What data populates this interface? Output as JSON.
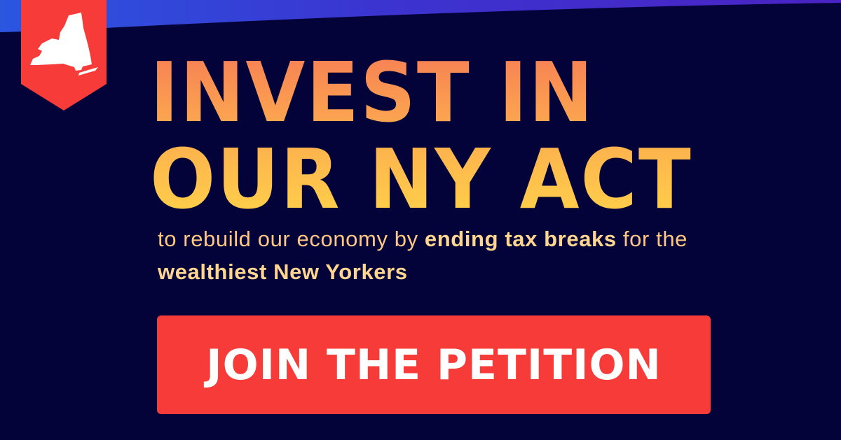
{
  "headline": {
    "line1": "INVEST IN",
    "line2": "OUR NY ACT"
  },
  "subtitle": {
    "part1": "to rebuild our economy by ",
    "emphasis1": "ending tax breaks",
    "part2": " for the ",
    "emphasis2": "wealthiest New Yorkers"
  },
  "cta": {
    "label": "JOIN THE PETITION"
  },
  "badge": {
    "icon": "new-york-state-icon"
  },
  "colors": {
    "background": "#03033a",
    "accent_red": "#f73b39",
    "headline_top": "#f77e55",
    "headline_bottom": "#ffd24a",
    "subtitle_text": "#ffc684",
    "swoosh_blue": "#2a3bd6",
    "swoosh_purple": "#4a23c4"
  }
}
